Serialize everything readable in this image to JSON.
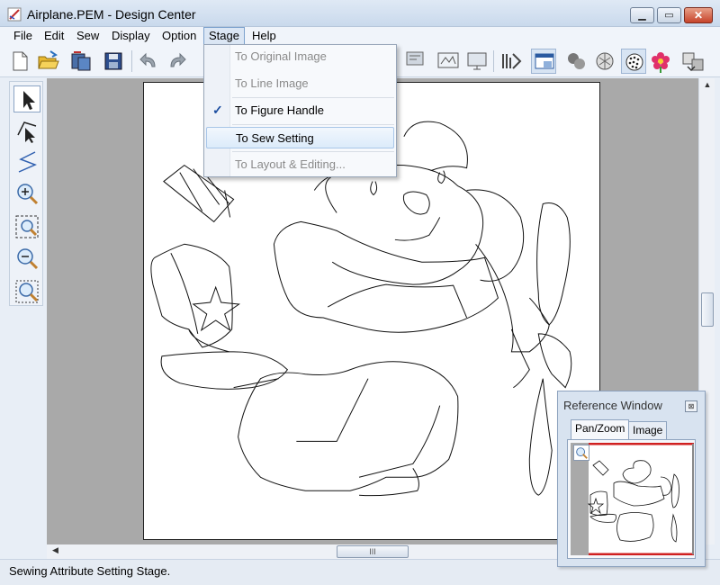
{
  "window": {
    "title": "Airplane.PEM - Design Center",
    "min_symbol": "▁",
    "max_symbol": "▭",
    "close_symbol": "✕"
  },
  "menubar": {
    "items": [
      "File",
      "Edit",
      "Sew",
      "Display",
      "Option",
      "Stage",
      "Help"
    ],
    "active": "Stage"
  },
  "stage_menu": {
    "items": [
      {
        "label": "To Original Image",
        "enabled": false,
        "checked": false
      },
      {
        "label": "To Line Image",
        "enabled": false,
        "checked": false
      },
      {
        "label": "To Figure Handle",
        "enabled": true,
        "checked": true
      },
      {
        "label": "To Sew Setting",
        "enabled": true,
        "checked": false,
        "highlighted": true
      },
      {
        "label": "To Layout & Editing...",
        "enabled": false,
        "checked": false
      }
    ],
    "check_symbol": "✓"
  },
  "toolbar": {
    "icons": [
      "new-file-icon",
      "open-folder-icon",
      "import-icon",
      "save-icon",
      "undo-icon",
      "redo-icon",
      "stitch-number-icon",
      "preview-icon",
      "monitor-icon",
      "sew-icon",
      "window-icon",
      "people-icon",
      "fill-icon",
      "pattern-icon",
      "flower-icon",
      "transfer-icon"
    ]
  },
  "palette": {
    "tools": [
      "select-arrow-icon",
      "point-edit-icon",
      "line-icon",
      "zoom-in-icon",
      "fit-icon",
      "zoom-out-icon",
      "zoom-region-icon"
    ]
  },
  "hscroll_grip": "III",
  "status": {
    "text": "Sewing Attribute Setting Stage."
  },
  "reference_window": {
    "title": "Reference Window",
    "close_symbol": "⊠",
    "tabs": [
      "Pan/Zoom",
      "Image"
    ],
    "active_tab": "Pan/Zoom"
  },
  "colors": {
    "titlebar": "#c9d9ec",
    "menu_highlight": "#dcebfa",
    "close_button": "#c6432a",
    "canvas_bg": "#a9a9a9",
    "ref_frame": "#d02020"
  }
}
